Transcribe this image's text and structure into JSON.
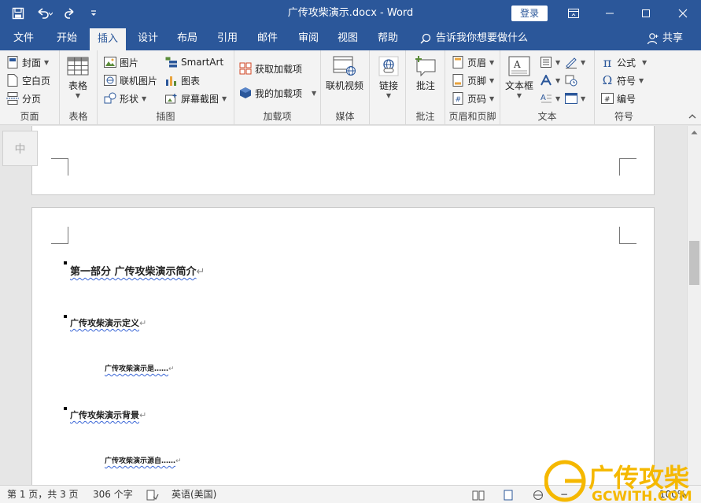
{
  "window": {
    "title": "广传攻柴演示.docx  -  Word",
    "login_label": "登录"
  },
  "tabs": [
    {
      "label": "文件"
    },
    {
      "label": "开始"
    },
    {
      "label": "插入"
    },
    {
      "label": "设计"
    },
    {
      "label": "布局"
    },
    {
      "label": "引用"
    },
    {
      "label": "邮件"
    },
    {
      "label": "审阅"
    },
    {
      "label": "视图"
    },
    {
      "label": "帮助"
    }
  ],
  "active_tab": "插入",
  "tell_me": "告诉我你想要做什么",
  "share": "共享",
  "ribbon": {
    "pages": {
      "label": "页面",
      "cover": "封面",
      "blank": "空白页",
      "break": "分页"
    },
    "table": {
      "label": "表格",
      "btn": "表格"
    },
    "illus": {
      "label": "插图",
      "picture": "图片",
      "online_picture": "联机图片",
      "shapes": "形状",
      "smartart": "SmartArt",
      "chart": "图表",
      "screenshot": "屏幕截图"
    },
    "addins": {
      "label": "加载项",
      "get": "获取加载项",
      "mine": "我的加载项"
    },
    "media": {
      "label": "媒体",
      "video": "联机视频"
    },
    "links": {
      "label": "",
      "link": "链接"
    },
    "comments": {
      "label": "批注",
      "btn": "批注"
    },
    "hf": {
      "label": "页眉和页脚",
      "header": "页眉",
      "footer": "页脚",
      "pagenum": "页码"
    },
    "text": {
      "label": "文本",
      "textbox": "文本框"
    },
    "symbols": {
      "label": "符号",
      "equation": "公式",
      "symbol": "符号",
      "number": "编号"
    }
  },
  "ime": "中",
  "document": {
    "p1": "第一部分  广传攻柴演示简介",
    "p2": "广传攻柴演示定义",
    "p3": "广传攻柴演示是……",
    "p4": "广传攻柴演示背景",
    "p5": "广传攻柴演示源自……",
    "para_mark": "↵"
  },
  "status": {
    "page": "第 1 页，共 3 页",
    "words": "306 个字",
    "lang": "英语(美国)",
    "zoom": "100%"
  },
  "watermark": {
    "cn": "广传攻柴",
    "en": "GCWITH.COM"
  },
  "colors": {
    "accent": "#2b579a",
    "watermark": "#f5b800"
  }
}
